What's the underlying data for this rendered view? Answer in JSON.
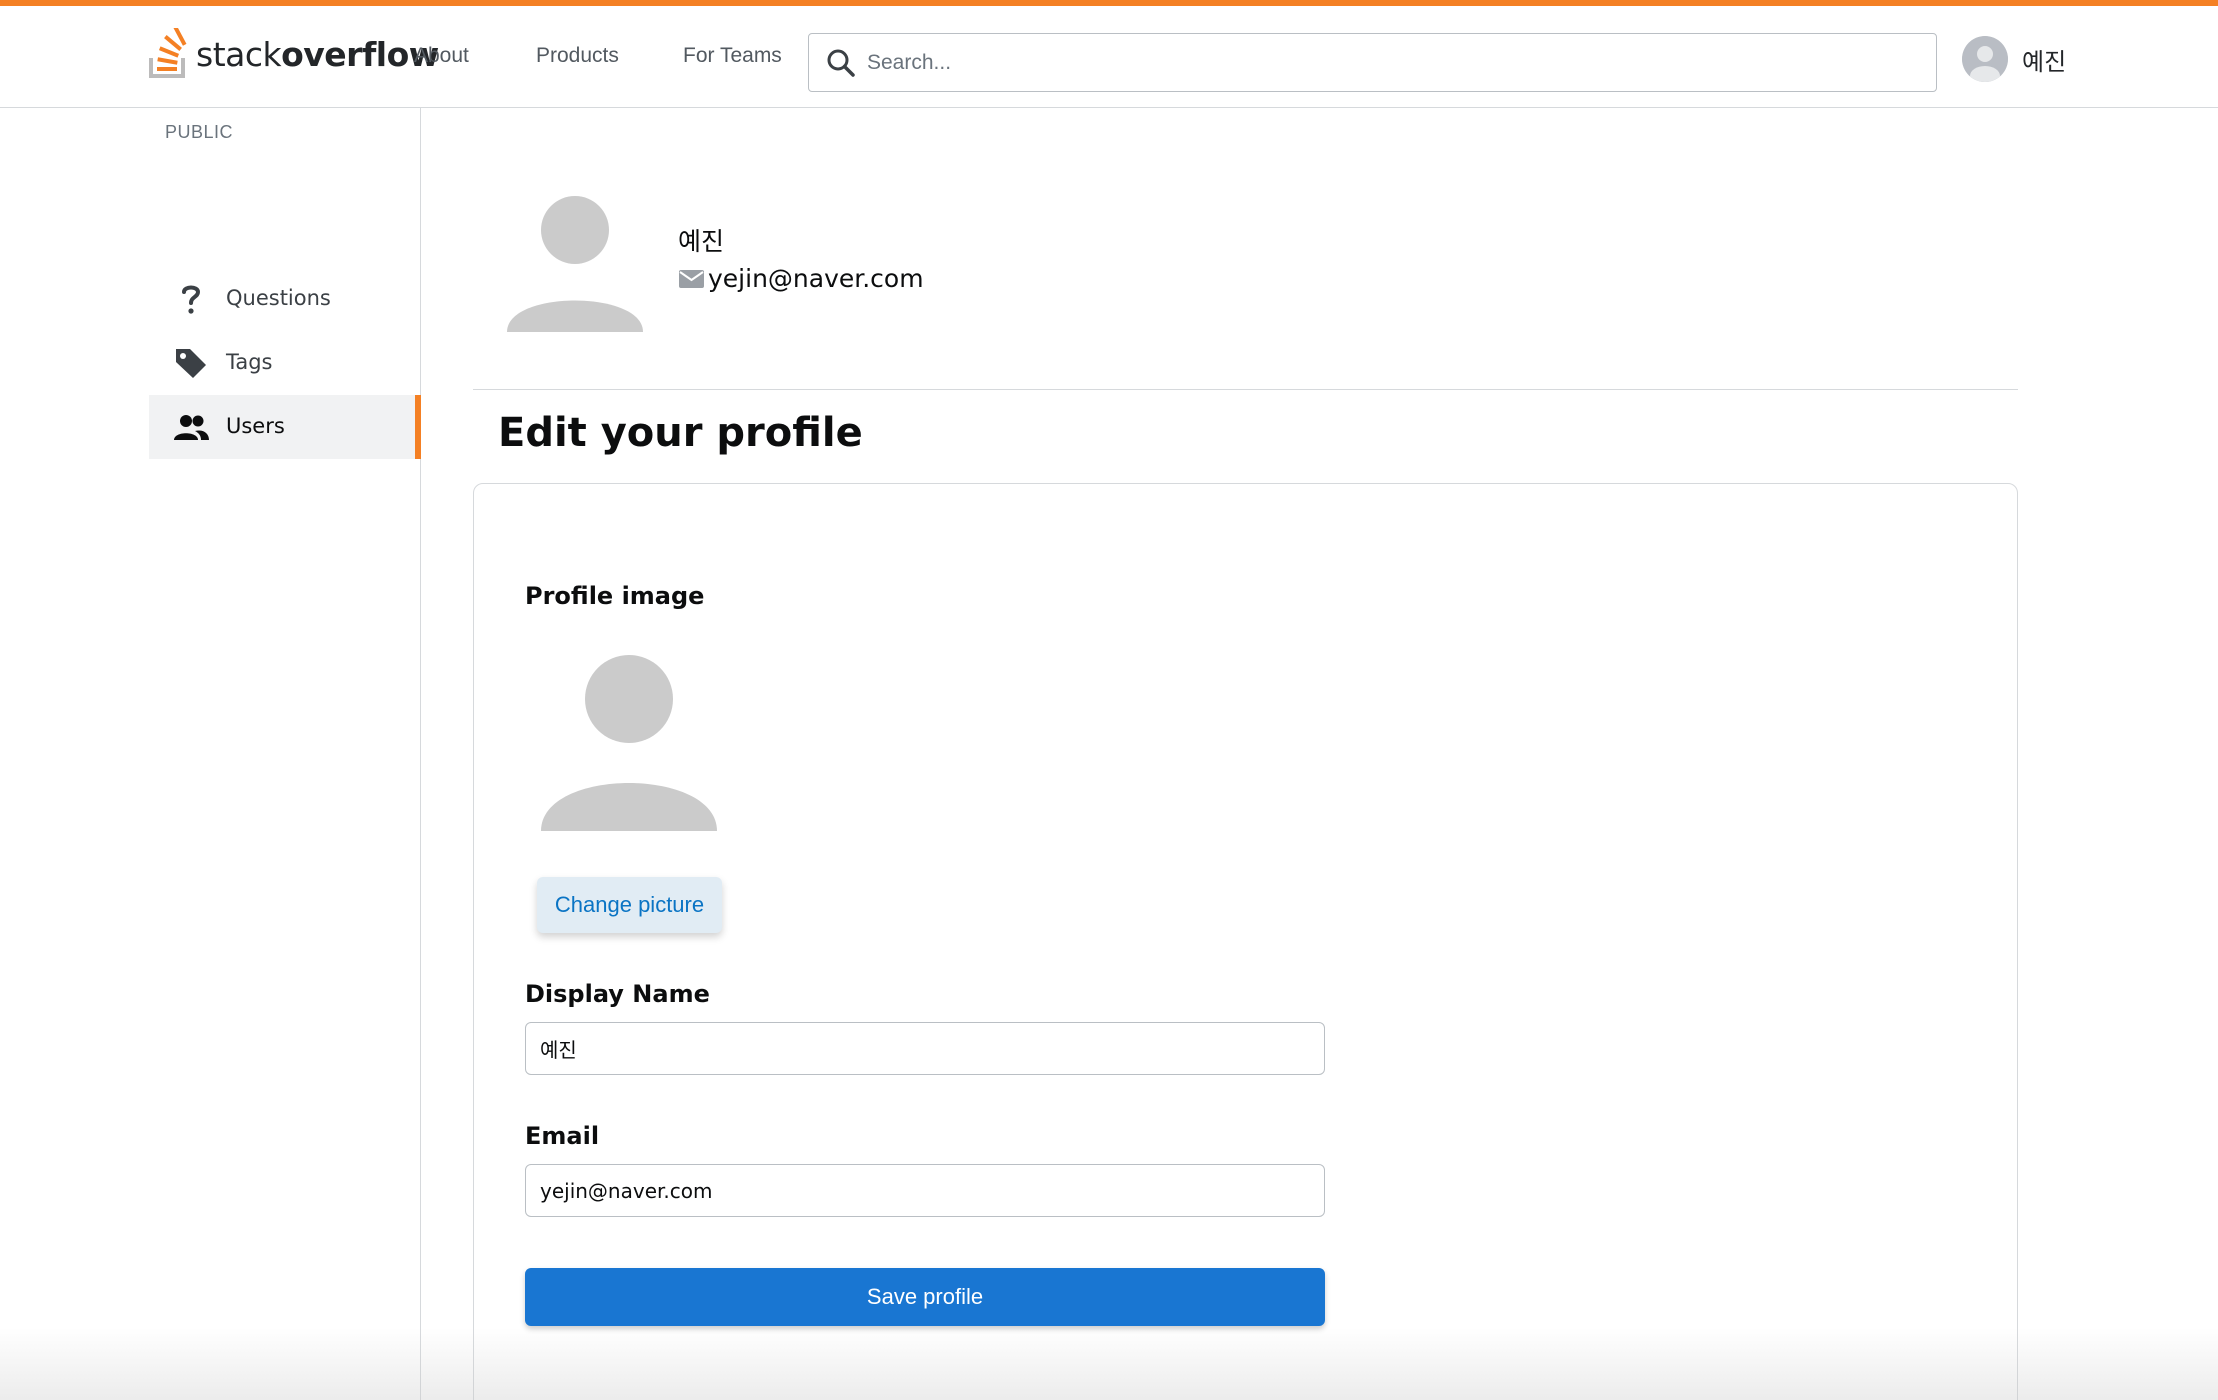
{
  "brand": {
    "logo_light": "stack",
    "logo_bold": "overflow",
    "accent": "#f48024",
    "primary": "#1976d2"
  },
  "topnav": {
    "links": [
      "About",
      "Products",
      "For Teams"
    ],
    "search_placeholder": "Search...",
    "user_name": "예진"
  },
  "sidebar": {
    "heading": "PUBLIC",
    "items": [
      {
        "label": "Questions",
        "icon": "question-icon"
      },
      {
        "label": "Tags",
        "icon": "tag-icon"
      },
      {
        "label": "Users",
        "icon": "users-icon",
        "active": true
      }
    ]
  },
  "profile": {
    "name": "예진",
    "email": "yejin@naver.com"
  },
  "edit": {
    "title": "Edit your profile",
    "image_label": "Profile image",
    "change_picture": "Change picture",
    "display_name_label": "Display Name",
    "display_name_value": "예진",
    "email_label": "Email",
    "email_value": "yejin@naver.com",
    "save_label": "Save profile"
  }
}
